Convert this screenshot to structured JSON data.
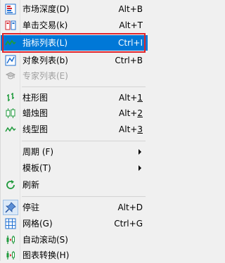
{
  "menu": {
    "items": [
      {
        "label": "市场深度(D)",
        "shortcut": "Alt+B",
        "icon": "market-depth-icon"
      },
      {
        "label": "单击交易(k)",
        "shortcut": "Alt+T",
        "icon": "one-click-trading-icon"
      },
      {
        "label": "指标列表(L)",
        "shortcut": "Ctrl+I",
        "icon": "indicator-list-icon"
      },
      {
        "label": "对象列表(b)",
        "shortcut": "Ctrl+B",
        "icon": "object-list-icon"
      },
      {
        "label": "专家列表(E)",
        "shortcut": "",
        "icon": "expert-list-icon"
      },
      {
        "label": "柱形图",
        "shortcut_prefix": "Alt+",
        "shortcut_key": "1",
        "icon": "bar-chart-icon"
      },
      {
        "label": "蜡烛图",
        "shortcut_prefix": "Alt+",
        "shortcut_key": "2",
        "icon": "candlestick-chart-icon"
      },
      {
        "label": "线型图",
        "shortcut_prefix": "Alt+",
        "shortcut_key": "3",
        "icon": "line-chart-icon"
      },
      {
        "label": "周期 (F)",
        "icon": ""
      },
      {
        "label": "模板(T)",
        "icon": ""
      },
      {
        "label": "刷新",
        "icon": "refresh-icon"
      },
      {
        "label": "停驻",
        "shortcut": "Alt+D",
        "icon": "dock-icon"
      },
      {
        "label": "网格(G)",
        "shortcut": "Ctrl+G",
        "icon": "grid-icon"
      },
      {
        "label": "自动滚动(S)",
        "icon": "auto-scroll-icon"
      },
      {
        "label": "图表转换(H)",
        "icon": "chart-shift-icon"
      }
    ]
  },
  "colors": {
    "selected": "#0078d7",
    "highlight_border": "#e0242a",
    "icon_green": "#1f9a3c",
    "icon_blue": "#1f6fd1",
    "icon_red": "#d4222a",
    "disabled": "#a0a0a0"
  }
}
